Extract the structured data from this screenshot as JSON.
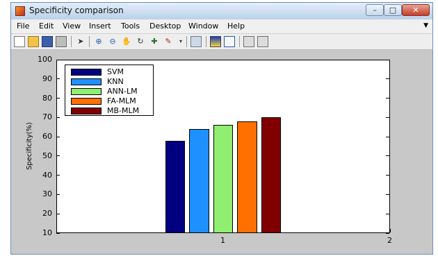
{
  "window": {
    "title": "Specificity comparison"
  },
  "menu": [
    "File",
    "Edit",
    "View",
    "Insert",
    "Tools",
    "Desktop",
    "Window",
    "Help"
  ],
  "toolbar": [
    "new-figure-icon",
    "open-file-icon",
    "save-icon",
    "print-icon",
    "pointer-icon",
    "zoom-in-icon",
    "zoom-out-icon",
    "pan-hand-icon",
    "rotate-3d-icon",
    "data-cursor-icon",
    "brush-icon",
    "link-plot-icon",
    "colorbar-icon",
    "legend-icon",
    "hide-plot-tools-icon",
    "show-plot-tools-icon"
  ],
  "colors": {
    "window_bg": "#c8c8c8",
    "axes_bg": "#ffffff"
  },
  "chart_data": {
    "type": "bar",
    "xlim": [
      0,
      2
    ],
    "ylim": [
      10,
      100
    ],
    "x_ticks": [
      "1",
      "2"
    ],
    "y_ticks": [
      10,
      20,
      30,
      40,
      50,
      60,
      70,
      80,
      90,
      100
    ],
    "ylabel": "Specificity(%)",
    "legend_position": "top-left",
    "series": [
      {
        "name": "SVM",
        "x": 1,
        "value": 58,
        "color": "#000080"
      },
      {
        "name": "KNN",
        "x": 1,
        "value": 64,
        "color": "#1e90ff"
      },
      {
        "name": "ANN-LM",
        "x": 1,
        "value": 66,
        "color": "#90ee70"
      },
      {
        "name": "FA-MLM",
        "x": 1,
        "value": 68,
        "color": "#ff7000"
      },
      {
        "name": "MB-MLM",
        "x": 1,
        "value": 70,
        "color": "#800000"
      }
    ]
  }
}
